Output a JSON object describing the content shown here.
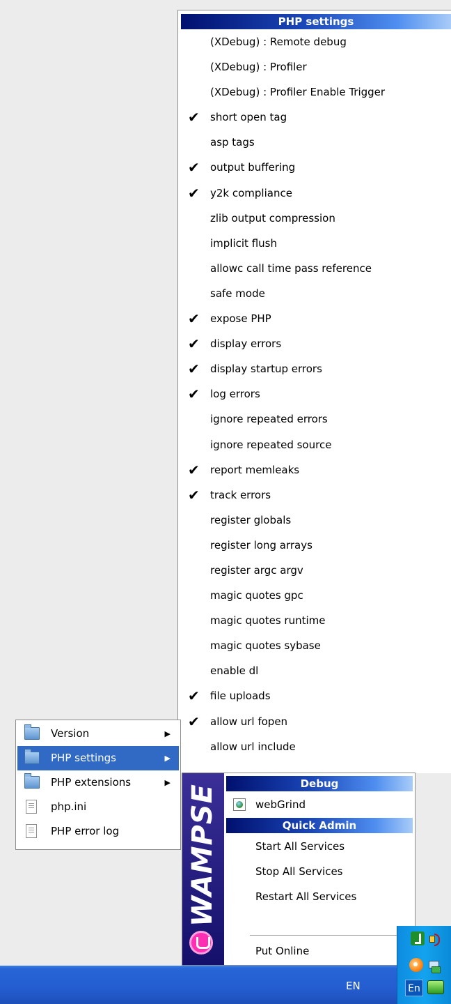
{
  "php_settings_menu": {
    "title": "PHP settings",
    "items": [
      {
        "label": "(XDebug) :  Remote debug",
        "check": ""
      },
      {
        "label": "(XDebug) :  Profiler",
        "check": ""
      },
      {
        "label": "(XDebug) :  Profiler Enable Trigger",
        "check": ""
      },
      {
        "label": "short open tag",
        "check": "✔"
      },
      {
        "label": "asp tags",
        "check": ""
      },
      {
        "label": "output buffering",
        "check": "✔"
      },
      {
        "label": "y2k compliance",
        "check": "✔"
      },
      {
        "label": "zlib output compression",
        "check": ""
      },
      {
        "label": "implicit flush",
        "check": ""
      },
      {
        "label": "allowc call time pass reference",
        "check": ""
      },
      {
        "label": "safe mode",
        "check": ""
      },
      {
        "label": "expose PHP",
        "check": "✔"
      },
      {
        "label": "display errors",
        "check": "✔"
      },
      {
        "label": "display startup errors",
        "check": "✔"
      },
      {
        "label": "log errors",
        "check": "✔"
      },
      {
        "label": "ignore repeated errors",
        "check": ""
      },
      {
        "label": "ignore repeated source",
        "check": ""
      },
      {
        "label": "report memleaks",
        "check": "✔"
      },
      {
        "label": "track errors",
        "check": "✔"
      },
      {
        "label": "register globals",
        "check": ""
      },
      {
        "label": "register long arrays",
        "check": ""
      },
      {
        "label": "register argc argv",
        "check": ""
      },
      {
        "label": "magic quotes gpc",
        "check": ""
      },
      {
        "label": "magic quotes runtime",
        "check": ""
      },
      {
        "label": "magic quotes sybase",
        "check": ""
      },
      {
        "label": "enable dl",
        "check": ""
      },
      {
        "label": "file uploads",
        "check": "✔"
      },
      {
        "label": "allow url fopen",
        "check": "✔"
      },
      {
        "label": "allow url include",
        "check": ""
      }
    ]
  },
  "php_menu": {
    "items": [
      {
        "label": "Version",
        "arrow": "▶",
        "icon": "folder-icon"
      },
      {
        "label": "PHP settings",
        "arrow": "▶",
        "icon": "folder-icon"
      },
      {
        "label": "PHP extensions",
        "arrow": "▶",
        "icon": "folder-icon"
      },
      {
        "label": "php.ini",
        "arrow": "",
        "icon": "file-icon"
      },
      {
        "label": "PHP error log",
        "arrow": "",
        "icon": "file-icon"
      }
    ]
  },
  "wamp_menu": {
    "brand": "WAMPSE",
    "debug_header": "Debug",
    "webgrind_label": "webGrind",
    "quick_admin_header": "Quick Admin",
    "start_all_services": "Start All Services",
    "stop_all_services": "Stop All Services",
    "restart_all_services": "Restart All Services",
    "put_online": "Put Online"
  },
  "taskbar": {
    "language": "EN",
    "language_box": "En"
  },
  "colors": {
    "menu_highlight": "#316ac5",
    "header_gradient_start": "#00106e",
    "header_gradient_end": "#a8ccf8",
    "taskbar": "#245dd0",
    "tray": "#14a3ee"
  }
}
